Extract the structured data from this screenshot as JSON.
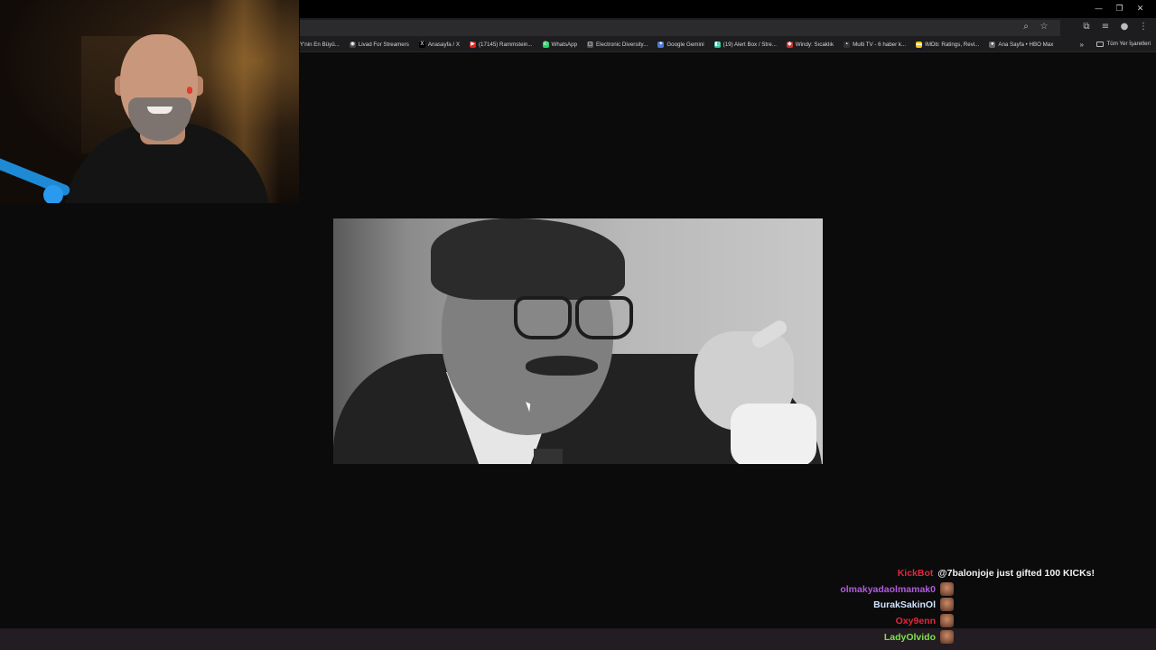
{
  "window": {
    "controls": [
      "—",
      "❐",
      "✕"
    ]
  },
  "toolbar": {
    "omnibox_icons": [
      "zoom-icon",
      "star-icon"
    ],
    "right_icons": [
      "extensions-icon",
      "media-icon",
      "profile-icon",
      "menu-icon"
    ]
  },
  "bookmarks": [
    {
      "label": "Y'nin En Büyü...",
      "icon": "",
      "color": "#3a3a3a"
    },
    {
      "label": "Livad For Streamers",
      "icon": "◉",
      "color": "#444444"
    },
    {
      "label": "Anasayfa / X",
      "icon": "X",
      "color": "#000000"
    },
    {
      "label": "(17145) Rammstein...",
      "icon": "▶",
      "color": "#e02020"
    },
    {
      "label": "WhatsApp",
      "icon": "✆",
      "color": "#25d366"
    },
    {
      "label": "Electronic Diversity...",
      "icon": "▢",
      "color": "#555555"
    },
    {
      "label": "Google Gemini",
      "icon": "✦",
      "color": "#4a7bd6"
    },
    {
      "label": "(19) Alert Box / Stre...",
      "icon": "◧",
      "color": "#31c4a4"
    },
    {
      "label": "Windy: Sıcaklık",
      "icon": "◆",
      "color": "#d03030"
    },
    {
      "label": "Multi TV - 6 haber k...",
      "icon": "▪",
      "color": "#333333"
    },
    {
      "label": "IMDb: Ratings, Revi...",
      "icon": "▬",
      "color": "#f5c518"
    },
    {
      "label": "Ana Sayfa • HBO Max",
      "icon": "●",
      "color": "#666666"
    }
  ],
  "bookmarks_more": "»",
  "bookmarks_folder": "Tüm Yer İşaretleri",
  "chat": {
    "messages": [
      {
        "user": "KickBot",
        "color": "#e0283c",
        "message": "@7balonjoje just gifted 100 KICKs!",
        "emote": false
      },
      {
        "user": "olmakyadaolmamak0",
        "color": "#b35be0",
        "message": "",
        "emote": true
      },
      {
        "user": "BurakSakinOl",
        "color": "#cfe3ff",
        "message": "",
        "emote": true
      },
      {
        "user": "Oxy9enn",
        "color": "#e0283c",
        "message": "",
        "emote": true
      },
      {
        "user": "LadyOlvido",
        "color": "#7ee04b",
        "message": "",
        "emote": true
      }
    ]
  }
}
